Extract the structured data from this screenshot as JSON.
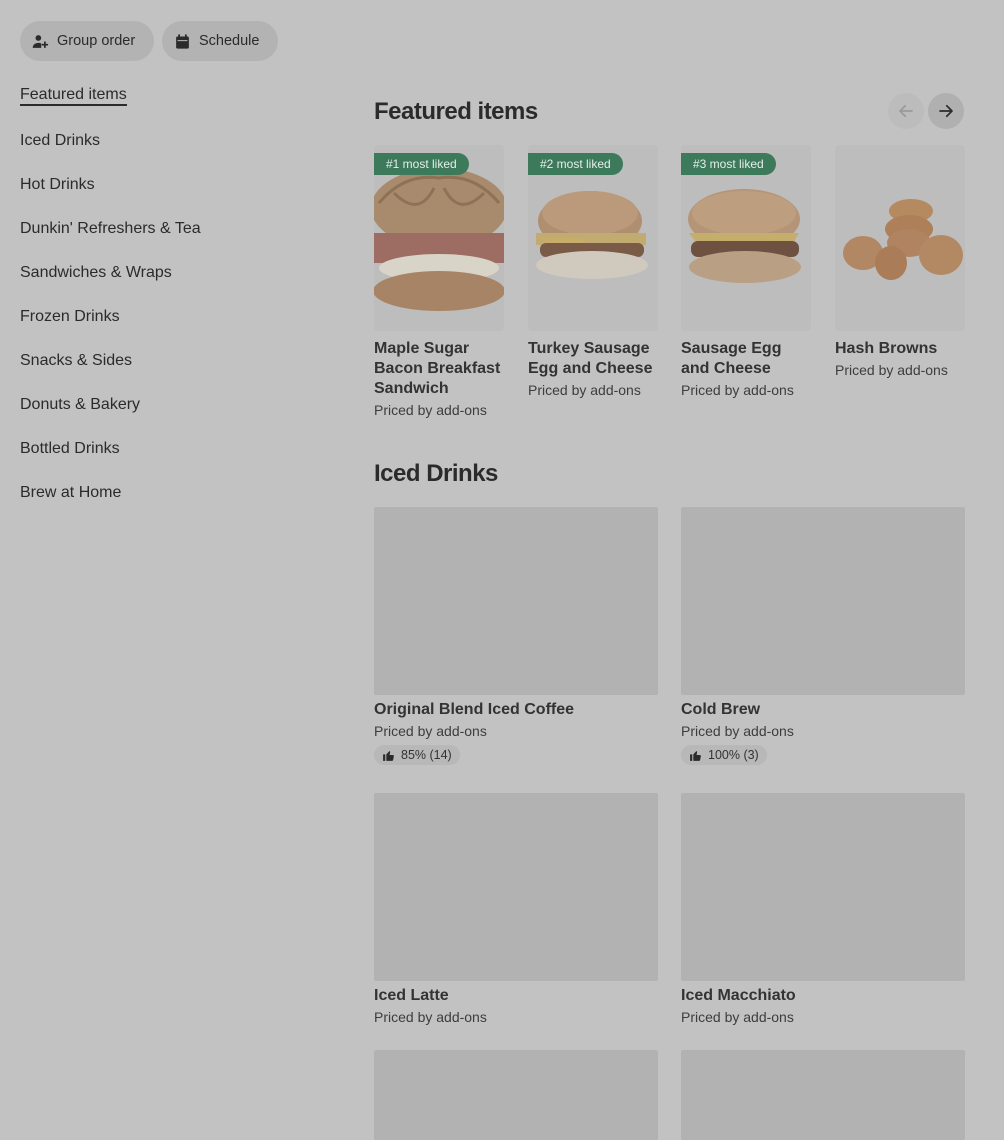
{
  "top_actions": {
    "group_order_label": "Group order",
    "schedule_label": "Schedule"
  },
  "nav": {
    "items": [
      {
        "label": "Featured items"
      },
      {
        "label": "Iced Drinks"
      },
      {
        "label": "Hot Drinks"
      },
      {
        "label": "Dunkin' Refreshers & Tea"
      },
      {
        "label": "Sandwiches & Wraps"
      },
      {
        "label": "Frozen Drinks"
      },
      {
        "label": "Snacks & Sides"
      },
      {
        "label": "Donuts & Bakery"
      },
      {
        "label": "Bottled Drinks"
      },
      {
        "label": "Brew at Home"
      }
    ]
  },
  "featured": {
    "title": "Featured items",
    "items": [
      {
        "badge": "#1 most liked",
        "name": "Maple Sugar Bacon Breakfast Sandwich",
        "price": "Priced by add-ons"
      },
      {
        "badge": "#2 most liked",
        "name": "Turkey Sausage Egg and Cheese",
        "price": "Priced by add-ons"
      },
      {
        "badge": "#3 most liked",
        "name": "Sausage Egg and Cheese",
        "price": "Priced by add-ons"
      },
      {
        "badge": "",
        "name": "Hash Browns",
        "price": "Priced by add-ons"
      }
    ]
  },
  "iced": {
    "title": "Iced Drinks",
    "items": [
      {
        "name": "Original Blend Iced Coffee",
        "price": "Priced by add-ons",
        "rating": "85% (14)"
      },
      {
        "name": "Cold Brew",
        "price": "Priced by add-ons",
        "rating": "100% (3)"
      },
      {
        "name": "Iced Latte",
        "price": "Priced by add-ons",
        "rating": ""
      },
      {
        "name": "Iced Macchiato",
        "price": "Priced by add-ons",
        "rating": ""
      }
    ]
  },
  "colors": {
    "overlay_bg": "#c2c2c2",
    "badge_green": "#3c7a5b"
  }
}
